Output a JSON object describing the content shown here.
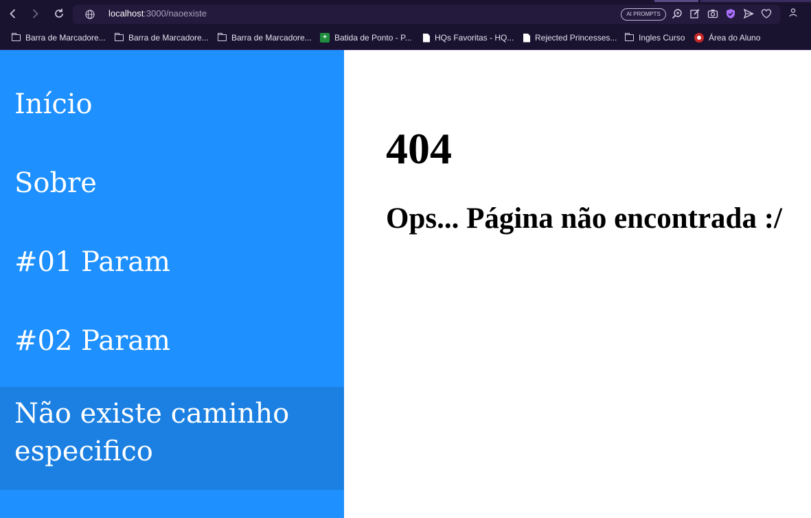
{
  "browser": {
    "url_host": "localhost",
    "url_path": ":3000/naoexiste",
    "ai_prompts_label": "AI PROMPTS",
    "icons": [
      "back-icon",
      "forward-icon",
      "reload-icon",
      "globe-icon",
      "zoom-icon",
      "edit-icon",
      "camera-icon",
      "shield-icon",
      "send-icon",
      "heart-icon",
      "profile-icon"
    ]
  },
  "bookmarks": [
    {
      "label": "Barra de Marcadore...",
      "icon": "folder-icon"
    },
    {
      "label": "Barra de Marcadore...",
      "icon": "folder-icon"
    },
    {
      "label": "Barra de Marcadore...",
      "icon": "folder-icon"
    },
    {
      "label": "Batida de Ponto - P...",
      "icon": "sheets-icon"
    },
    {
      "label": "HQs Favoritas - HQ...",
      "icon": "document-icon"
    },
    {
      "label": "Rejected Princesses...",
      "icon": "document-icon"
    },
    {
      "label": "Ingles Curso",
      "icon": "folder-icon"
    },
    {
      "label": "Área do Aluno",
      "icon": "site-favicon"
    }
  ],
  "sidebar": {
    "items": [
      {
        "label": "Início"
      },
      {
        "label": "Sobre"
      },
      {
        "label": "#01 Param"
      },
      {
        "label": "#02 Param"
      },
      {
        "label": "Não existe caminho especifico",
        "active": true
      }
    ]
  },
  "main": {
    "code": "404",
    "message": "Ops... Página não encontrada :/"
  },
  "colors": {
    "sidebar_bg": "#1e90ff",
    "sidebar_active_bg": "#1b80e2",
    "browser_chrome": "#1a1330"
  }
}
